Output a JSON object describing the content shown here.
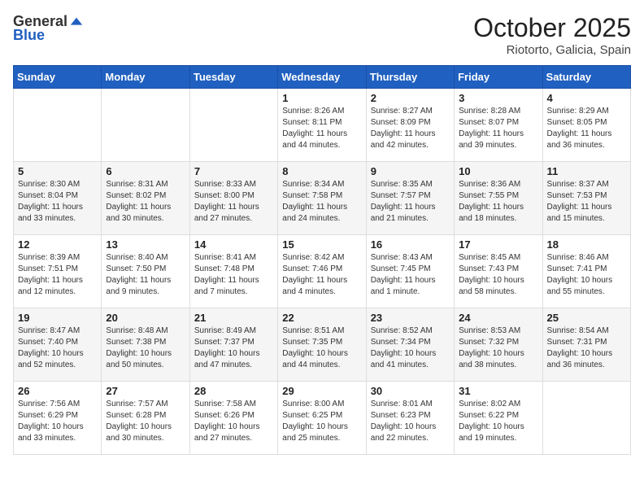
{
  "header": {
    "logo_general": "General",
    "logo_blue": "Blue",
    "month_year": "October 2025",
    "location": "Riotorto, Galicia, Spain"
  },
  "weekdays": [
    "Sunday",
    "Monday",
    "Tuesday",
    "Wednesday",
    "Thursday",
    "Friday",
    "Saturday"
  ],
  "weeks": [
    [
      {
        "day": "",
        "sunrise": "",
        "sunset": "",
        "daylight": ""
      },
      {
        "day": "",
        "sunrise": "",
        "sunset": "",
        "daylight": ""
      },
      {
        "day": "",
        "sunrise": "",
        "sunset": "",
        "daylight": ""
      },
      {
        "day": "1",
        "sunrise": "Sunrise: 8:26 AM",
        "sunset": "Sunset: 8:11 PM",
        "daylight": "Daylight: 11 hours and 44 minutes."
      },
      {
        "day": "2",
        "sunrise": "Sunrise: 8:27 AM",
        "sunset": "Sunset: 8:09 PM",
        "daylight": "Daylight: 11 hours and 42 minutes."
      },
      {
        "day": "3",
        "sunrise": "Sunrise: 8:28 AM",
        "sunset": "Sunset: 8:07 PM",
        "daylight": "Daylight: 11 hours and 39 minutes."
      },
      {
        "day": "4",
        "sunrise": "Sunrise: 8:29 AM",
        "sunset": "Sunset: 8:05 PM",
        "daylight": "Daylight: 11 hours and 36 minutes."
      }
    ],
    [
      {
        "day": "5",
        "sunrise": "Sunrise: 8:30 AM",
        "sunset": "Sunset: 8:04 PM",
        "daylight": "Daylight: 11 hours and 33 minutes."
      },
      {
        "day": "6",
        "sunrise": "Sunrise: 8:31 AM",
        "sunset": "Sunset: 8:02 PM",
        "daylight": "Daylight: 11 hours and 30 minutes."
      },
      {
        "day": "7",
        "sunrise": "Sunrise: 8:33 AM",
        "sunset": "Sunset: 8:00 PM",
        "daylight": "Daylight: 11 hours and 27 minutes."
      },
      {
        "day": "8",
        "sunrise": "Sunrise: 8:34 AM",
        "sunset": "Sunset: 7:58 PM",
        "daylight": "Daylight: 11 hours and 24 minutes."
      },
      {
        "day": "9",
        "sunrise": "Sunrise: 8:35 AM",
        "sunset": "Sunset: 7:57 PM",
        "daylight": "Daylight: 11 hours and 21 minutes."
      },
      {
        "day": "10",
        "sunrise": "Sunrise: 8:36 AM",
        "sunset": "Sunset: 7:55 PM",
        "daylight": "Daylight: 11 hours and 18 minutes."
      },
      {
        "day": "11",
        "sunrise": "Sunrise: 8:37 AM",
        "sunset": "Sunset: 7:53 PM",
        "daylight": "Daylight: 11 hours and 15 minutes."
      }
    ],
    [
      {
        "day": "12",
        "sunrise": "Sunrise: 8:39 AM",
        "sunset": "Sunset: 7:51 PM",
        "daylight": "Daylight: 11 hours and 12 minutes."
      },
      {
        "day": "13",
        "sunrise": "Sunrise: 8:40 AM",
        "sunset": "Sunset: 7:50 PM",
        "daylight": "Daylight: 11 hours and 9 minutes."
      },
      {
        "day": "14",
        "sunrise": "Sunrise: 8:41 AM",
        "sunset": "Sunset: 7:48 PM",
        "daylight": "Daylight: 11 hours and 7 minutes."
      },
      {
        "day": "15",
        "sunrise": "Sunrise: 8:42 AM",
        "sunset": "Sunset: 7:46 PM",
        "daylight": "Daylight: 11 hours and 4 minutes."
      },
      {
        "day": "16",
        "sunrise": "Sunrise: 8:43 AM",
        "sunset": "Sunset: 7:45 PM",
        "daylight": "Daylight: 11 hours and 1 minute."
      },
      {
        "day": "17",
        "sunrise": "Sunrise: 8:45 AM",
        "sunset": "Sunset: 7:43 PM",
        "daylight": "Daylight: 10 hours and 58 minutes."
      },
      {
        "day": "18",
        "sunrise": "Sunrise: 8:46 AM",
        "sunset": "Sunset: 7:41 PM",
        "daylight": "Daylight: 10 hours and 55 minutes."
      }
    ],
    [
      {
        "day": "19",
        "sunrise": "Sunrise: 8:47 AM",
        "sunset": "Sunset: 7:40 PM",
        "daylight": "Daylight: 10 hours and 52 minutes."
      },
      {
        "day": "20",
        "sunrise": "Sunrise: 8:48 AM",
        "sunset": "Sunset: 7:38 PM",
        "daylight": "Daylight: 10 hours and 50 minutes."
      },
      {
        "day": "21",
        "sunrise": "Sunrise: 8:49 AM",
        "sunset": "Sunset: 7:37 PM",
        "daylight": "Daylight: 10 hours and 47 minutes."
      },
      {
        "day": "22",
        "sunrise": "Sunrise: 8:51 AM",
        "sunset": "Sunset: 7:35 PM",
        "daylight": "Daylight: 10 hours and 44 minutes."
      },
      {
        "day": "23",
        "sunrise": "Sunrise: 8:52 AM",
        "sunset": "Sunset: 7:34 PM",
        "daylight": "Daylight: 10 hours and 41 minutes."
      },
      {
        "day": "24",
        "sunrise": "Sunrise: 8:53 AM",
        "sunset": "Sunset: 7:32 PM",
        "daylight": "Daylight: 10 hours and 38 minutes."
      },
      {
        "day": "25",
        "sunrise": "Sunrise: 8:54 AM",
        "sunset": "Sunset: 7:31 PM",
        "daylight": "Daylight: 10 hours and 36 minutes."
      }
    ],
    [
      {
        "day": "26",
        "sunrise": "Sunrise: 7:56 AM",
        "sunset": "Sunset: 6:29 PM",
        "daylight": "Daylight: 10 hours and 33 minutes."
      },
      {
        "day": "27",
        "sunrise": "Sunrise: 7:57 AM",
        "sunset": "Sunset: 6:28 PM",
        "daylight": "Daylight: 10 hours and 30 minutes."
      },
      {
        "day": "28",
        "sunrise": "Sunrise: 7:58 AM",
        "sunset": "Sunset: 6:26 PM",
        "daylight": "Daylight: 10 hours and 27 minutes."
      },
      {
        "day": "29",
        "sunrise": "Sunrise: 8:00 AM",
        "sunset": "Sunset: 6:25 PM",
        "daylight": "Daylight: 10 hours and 25 minutes."
      },
      {
        "day": "30",
        "sunrise": "Sunrise: 8:01 AM",
        "sunset": "Sunset: 6:23 PM",
        "daylight": "Daylight: 10 hours and 22 minutes."
      },
      {
        "day": "31",
        "sunrise": "Sunrise: 8:02 AM",
        "sunset": "Sunset: 6:22 PM",
        "daylight": "Daylight: 10 hours and 19 minutes."
      },
      {
        "day": "",
        "sunrise": "",
        "sunset": "",
        "daylight": ""
      }
    ]
  ]
}
